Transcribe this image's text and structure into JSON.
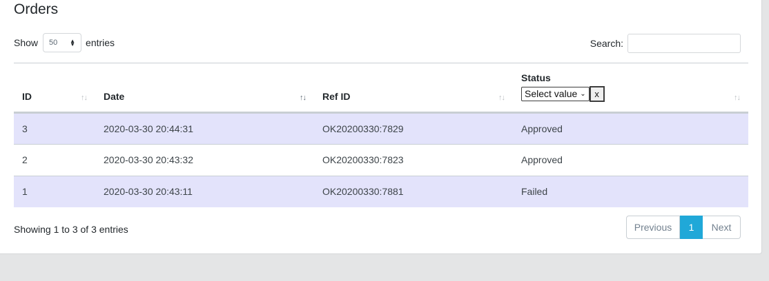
{
  "page": {
    "title": "Orders"
  },
  "length_control": {
    "prefix": "Show",
    "selected": "50",
    "suffix": "entries"
  },
  "search": {
    "label": "Search:",
    "value": ""
  },
  "table": {
    "columns": [
      {
        "label": "ID",
        "sort": "none"
      },
      {
        "label": "Date",
        "sort": "desc"
      },
      {
        "label": "Ref ID",
        "sort": "none"
      },
      {
        "label": "Status",
        "sort": "none"
      }
    ],
    "status_filter": {
      "selected": "Select value",
      "clear_label": "x"
    },
    "rows": [
      {
        "id": "3",
        "date": "2020-03-30 20:44:31",
        "ref": "OK20200330:7829",
        "status": "Approved"
      },
      {
        "id": "2",
        "date": "2020-03-30 20:43:32",
        "ref": "OK20200330:7823",
        "status": "Approved"
      },
      {
        "id": "1",
        "date": "2020-03-30 20:43:11",
        "ref": "OK20200330:7881",
        "status": "Failed"
      }
    ]
  },
  "footer": {
    "info": "Showing 1 to 3 of 3 entries",
    "pagination": {
      "previous": "Previous",
      "current": "1",
      "next": "Next"
    }
  },
  "icons": {
    "sort_none": "sort-arrows-icon",
    "sort_desc": "sort-desc-icon",
    "select_chevron": "chevron-down-icon"
  },
  "colors": {
    "row_stripe": "#e3e3fb",
    "accent": "#20a8d8"
  }
}
